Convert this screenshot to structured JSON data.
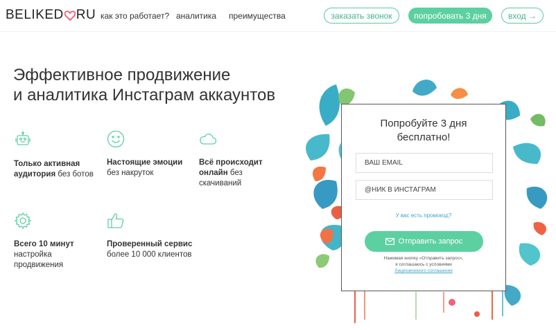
{
  "header": {
    "logo_left": "BELIKED",
    "logo_right": "RU",
    "nav": [
      "как это работает?",
      "аналитика",
      "преимущества"
    ],
    "btn_call": "заказать звонок",
    "btn_try": "попробовать 3 дня",
    "btn_login": "вход →"
  },
  "hero": {
    "title_line1": "Эффективное продвижение",
    "title_line2": "и аналитика Инстаграм аккаунтов"
  },
  "features": [
    {
      "icon": "robot-icon",
      "bold": "Только активная аудитория",
      "text": " без ботов"
    },
    {
      "icon": "smile-icon",
      "bold": "Настоящие эмоции",
      "text": "без накруток"
    },
    {
      "icon": "cloud-icon",
      "bold": "Всё происходит онлайн",
      "text": " без скачиваний"
    },
    {
      "icon": "gear-icon",
      "bold": "Всего 10 минут",
      "text": "настройка продвижения"
    },
    {
      "icon": "thumbs-up-icon",
      "bold": "Проверенный сервис",
      "text": "более 10 000 клиентов"
    }
  ],
  "form": {
    "title_line1": "Попробуйте 3 дня",
    "title_line2": "бесплатно!",
    "email_placeholder": "ВАШ EMAIL",
    "nick_placeholder": "@НИК В ИНСТАГРАМ",
    "promo": "У вас есть промокод?",
    "submit": "Отправить запрос",
    "note_line1": "Нажимая кнопку «Отправить запрос»,",
    "note_line2": "я соглашаюсь с условиями",
    "note_link": "Лицензионного соглашения"
  },
  "colors": {
    "accent": "#5dd0a1",
    "link": "#3aa6c9",
    "heart": "#ef5b73"
  }
}
